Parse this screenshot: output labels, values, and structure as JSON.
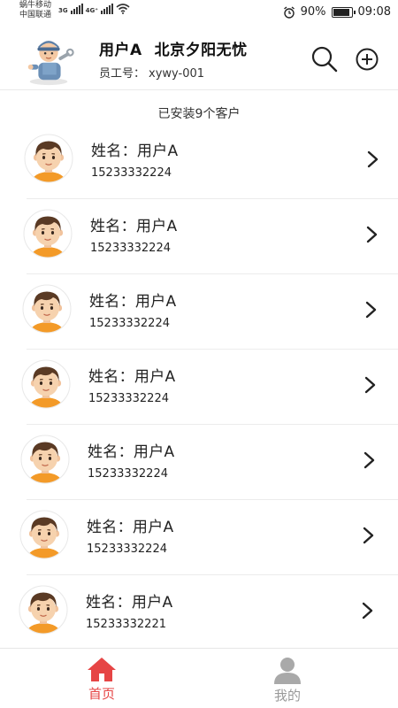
{
  "status_bar": {
    "carrier_top": "蜗牛移动",
    "carrier_bottom": "中国联通",
    "signal_1": "3G",
    "signal_2": "4G⁺",
    "battery_percent": "90%",
    "battery_level": 0.9,
    "time": "09:08",
    "icons": [
      "alarm-icon",
      "wifi-icon",
      "signal-icon",
      "battery-icon"
    ]
  },
  "header": {
    "user": "用户A",
    "company": "北京夕阳无忧",
    "employee_label": "员工号：",
    "employee_id": "xywy-001",
    "icons": [
      "worker-avatar",
      "search-icon",
      "add-icon"
    ]
  },
  "list": {
    "title": "已安装9个客户",
    "name_label": "姓名：",
    "customers": [
      {
        "name": "用户A",
        "phone": "15233332224"
      },
      {
        "name": "用户A",
        "phone": "15233332224"
      },
      {
        "name": "用户A",
        "phone": "15233332224"
      },
      {
        "name": "用户A",
        "phone": "15233332224"
      },
      {
        "name": "用户A",
        "phone": "15233332224"
      },
      {
        "name": "用户A",
        "phone": "15233332224"
      },
      {
        "name": "用户A",
        "phone": "15233332221"
      }
    ]
  },
  "bottom_nav": {
    "home": "首页",
    "mine": "我的",
    "active": "home"
  },
  "colors": {
    "accent": "#e64545",
    "inactive": "#999999",
    "avatar_shirt": "#f39a28",
    "avatar_hair": "#5a3a24",
    "avatar_skin": "#f6d2ae"
  }
}
